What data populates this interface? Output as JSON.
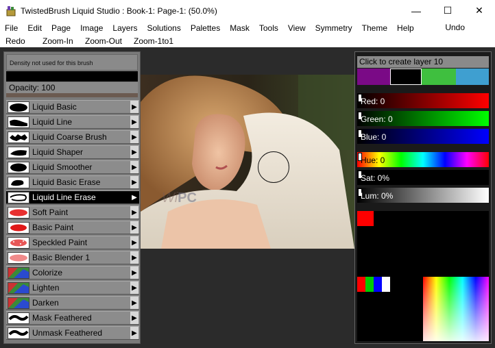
{
  "window": {
    "title": "TwistedBrush Liquid Studio : Book-1: Page-1:  (50.0%)",
    "minimize": "—",
    "maximize": "☐",
    "close": "✕"
  },
  "menu": [
    "File",
    "Edit",
    "Page",
    "Image",
    "Layers",
    "Solutions",
    "Palettes",
    "Mask",
    "Tools",
    "View",
    "Symmetry",
    "Theme",
    "Help"
  ],
  "undo": "Undo",
  "toolbar": [
    "Redo",
    "Zoom-In",
    "Zoom-Out",
    "Zoom-1to1"
  ],
  "left_panel": {
    "density_text": "Density not used for this brush",
    "opacity_text": "Opacity: 100",
    "brushes": [
      {
        "label": "Liquid Basic",
        "selected": false,
        "thumb": "black-blob"
      },
      {
        "label": "Liquid Line",
        "selected": false,
        "thumb": "black-blob"
      },
      {
        "label": "Liquid Coarse Brush",
        "selected": false,
        "thumb": "black-rough"
      },
      {
        "label": "Liquid Shaper",
        "selected": false,
        "thumb": "black-blob"
      },
      {
        "label": "Liquid Smoother",
        "selected": false,
        "thumb": "black-blob"
      },
      {
        "label": "Liquid Basic Erase",
        "selected": false,
        "thumb": "black-blob"
      },
      {
        "label": "Liquid Line Erase",
        "selected": true,
        "thumb": "black-outline"
      },
      {
        "label": "Soft Paint",
        "selected": false,
        "thumb": "red-soft"
      },
      {
        "label": "Basic Paint",
        "selected": false,
        "thumb": "red-blob"
      },
      {
        "label": "Speckled Paint",
        "selected": false,
        "thumb": "red-speckle"
      },
      {
        "label": "Basic Blender 1",
        "selected": false,
        "thumb": "red-blend"
      },
      {
        "label": "Colorize",
        "selected": false,
        "thumb": "color-mix"
      },
      {
        "label": "Lighten",
        "selected": false,
        "thumb": "color-mix"
      },
      {
        "label": "Darken",
        "selected": false,
        "thumb": "color-mix"
      },
      {
        "label": "Mask Feathered",
        "selected": false,
        "thumb": "black-wave"
      },
      {
        "label": "Unmask Feathered",
        "selected": false,
        "thumb": "black-wave"
      }
    ]
  },
  "watermark": {
    "italic": "Wi",
    "bold": "PC"
  },
  "right_panel": {
    "layer_label": "Click to create layer 10",
    "swatches": [
      "#7a0a86",
      "#000000",
      "#3fbf3f",
      "#3f9fd0"
    ],
    "red_label": "Red: 0",
    "green_label": "Green: 0",
    "blue_label": "Blue: 0",
    "hue_label": "Hue: 0",
    "sat_label": "Sat: 0%",
    "lum_label": "Lum: 0%"
  }
}
